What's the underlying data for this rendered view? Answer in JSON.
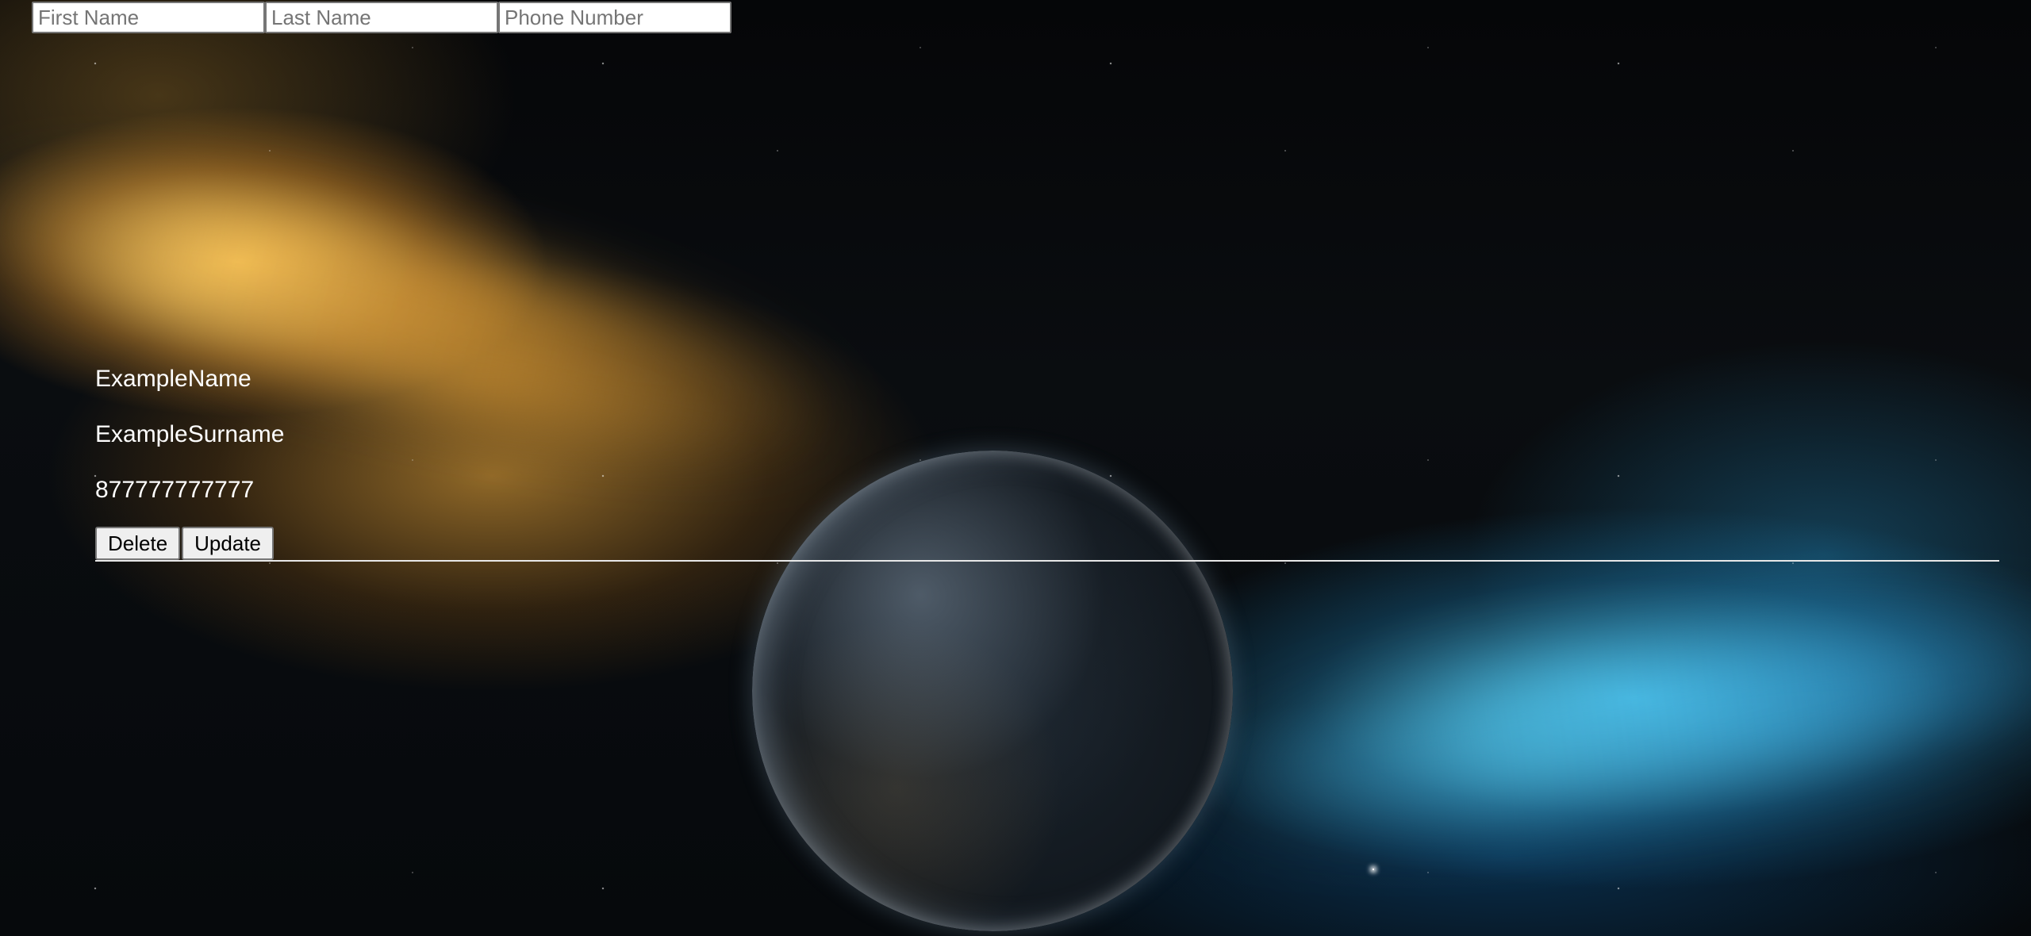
{
  "form": {
    "first_name_placeholder": "First Name",
    "last_name_placeholder": "Last Name",
    "phone_placeholder": "Phone Number"
  },
  "contacts": [
    {
      "first_name": "ExampleName",
      "last_name": "ExampleSurname",
      "phone": "877777777777",
      "delete_label": "Delete",
      "update_label": "Update"
    }
  ]
}
